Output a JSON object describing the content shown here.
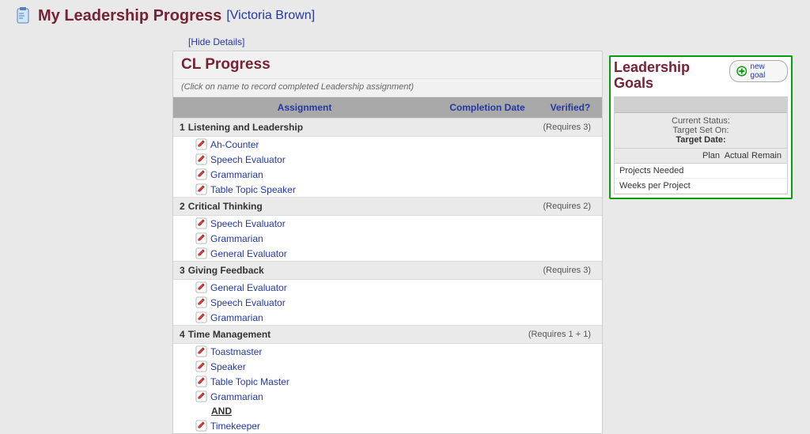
{
  "header": {
    "page_title": "My Leadership Progress",
    "user_name": "[Victoria Brown]"
  },
  "hide_details_label": "[Hide Details]",
  "main": {
    "title": "CL Progress",
    "hint": "(Click on name to record completed Leadership assignment)",
    "columns": {
      "assignment": "Assignment",
      "completion_date": "Completion Date",
      "verified": "Verified?"
    },
    "sections": [
      {
        "num": "1",
        "title": "Listening and Leadership",
        "req": "(Requires 3)",
        "items": [
          "Ah-Counter",
          "Speech Evaluator",
          "Grammarian",
          "Table Topic Speaker"
        ]
      },
      {
        "num": "2",
        "title": "Critical Thinking",
        "req": "(Requires 2)",
        "items": [
          "Speech Evaluator",
          "Grammarian",
          "General Evaluator"
        ]
      },
      {
        "num": "3",
        "title": "Giving Feedback",
        "req": "(Requires 3)",
        "items": [
          "General Evaluator",
          "Speech Evaluator",
          "Grammarian"
        ]
      },
      {
        "num": "4",
        "title": "Time Management",
        "req": "(Requires 1 + 1)",
        "items": [
          "Toastmaster",
          "Speaker",
          "Table Topic Master",
          "Grammarian"
        ],
        "and_label": "AND",
        "after_and": [
          "Timekeeper"
        ]
      }
    ]
  },
  "goals": {
    "title": "Leadership Goals",
    "new_goal_label": "new goal",
    "status": {
      "current_label": "Current Status:",
      "target_set_label": "Target Set On:",
      "target_date_label": "Target Date:"
    },
    "table": {
      "plan": "Plan",
      "actual": "Actual",
      "remain": "Remain",
      "rows": [
        {
          "label": "Projects Needed"
        },
        {
          "label": "Weeks per Project"
        }
      ]
    }
  }
}
